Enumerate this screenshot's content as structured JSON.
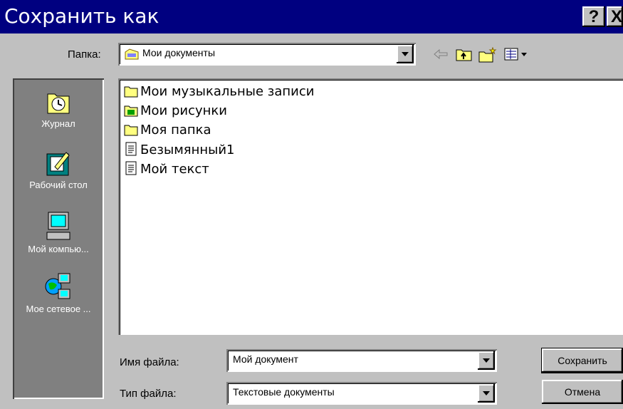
{
  "window": {
    "title": "Сохранить как",
    "help_label": "?",
    "close_label": "X"
  },
  "folder": {
    "label": "Папка:",
    "value": "Мои документы"
  },
  "places": [
    {
      "label": "Журнал",
      "icon": "history-icon"
    },
    {
      "label": "Рабочий стол",
      "icon": "desktop-icon"
    },
    {
      "label": "Мой компью...",
      "icon": "my-computer-icon"
    },
    {
      "label": "Мое сетевое ...",
      "icon": "network-icon"
    }
  ],
  "files": [
    {
      "name": "Мои музыкальные записи",
      "icon": "folder-icon"
    },
    {
      "name": "Мои рисунки",
      "icon": "pictures-folder-icon"
    },
    {
      "name": "Моя папка",
      "icon": "folder-icon"
    },
    {
      "name": "Безымянный1",
      "icon": "document-icon"
    },
    {
      "name": "Мой текст",
      "icon": "document-icon"
    }
  ],
  "filename": {
    "label": "Имя файла:",
    "value": "Мой документ"
  },
  "filetype": {
    "label": "Тип файла:",
    "value": "Текстовые документы"
  },
  "buttons": {
    "save": "Сохранить",
    "cancel": "Отмена"
  }
}
